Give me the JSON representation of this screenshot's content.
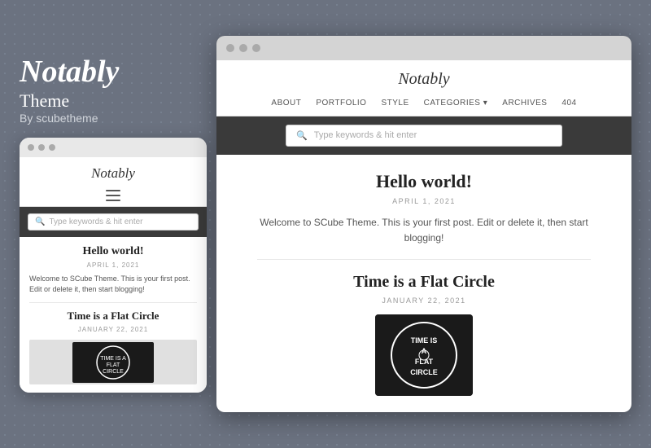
{
  "brand": {
    "title": "Notably",
    "subtitle": "Theme",
    "author": "By scubetheme"
  },
  "colors": {
    "background": "#6b7280",
    "dot_bg": "#7a8494",
    "dark_nav": "#3a3a3a",
    "white": "#ffffff"
  },
  "mobile": {
    "site_title": "Notably",
    "search_placeholder": "Type keywords & hit enter",
    "post1": {
      "title": "Hello world!",
      "date": "APRIL 1, 2021",
      "excerpt": "Welcome to SCube Theme. This is your first post. Edit or delete it, then start blogging!"
    },
    "post2": {
      "title": "Time is a Flat Circle",
      "date": "JANUARY 22, 2021"
    }
  },
  "desktop": {
    "site_title": "Notably",
    "nav_items": [
      "ABOUT",
      "PORTFOLIO",
      "STYLE",
      "CATEGORIES ▾",
      "ARCHIVES",
      "404"
    ],
    "search_placeholder": "Type keywords & hit enter",
    "post1": {
      "title": "Hello world!",
      "date": "APRIL 1, 2021",
      "excerpt": "Welcome to SCube Theme. This is your first post. Edit or delete it, then start blogging!"
    },
    "post2": {
      "title": "Time is a Flat Circle",
      "date": "JANUARY 22, 2021"
    }
  }
}
